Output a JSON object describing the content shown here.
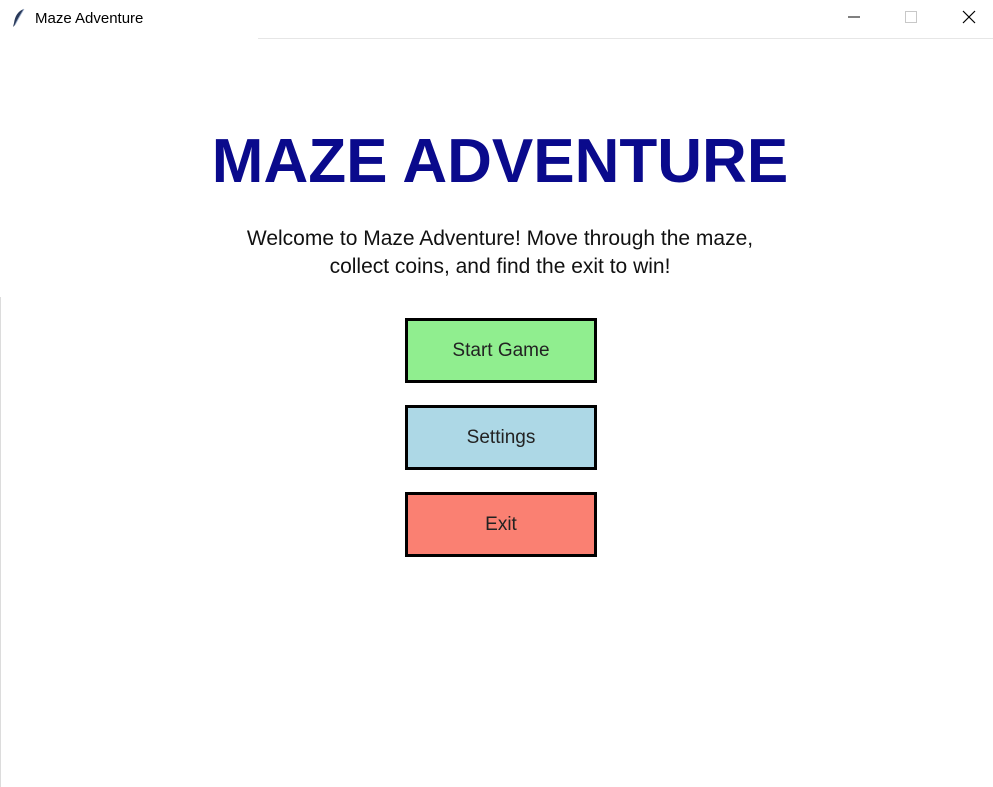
{
  "window": {
    "title": "Maze Adventure",
    "app_icon": "feather-icon",
    "controls": {
      "minimize_icon": "minimize-icon",
      "maximize_icon": "maximize-icon",
      "close_icon": "close-icon"
    }
  },
  "main": {
    "heading": "MAZE ADVENTURE",
    "subtitle_line1": "Welcome to Maze Adventure! Move through the maze,",
    "subtitle_line2": "collect coins, and find the exit to win!",
    "heading_color": "#0a0a8c"
  },
  "menu": {
    "start_label": "Start Game",
    "start_color": "#90ee8f",
    "settings_label": "Settings",
    "settings_color": "#add8e6",
    "exit_label": "Exit",
    "exit_color": "#fa8072"
  }
}
